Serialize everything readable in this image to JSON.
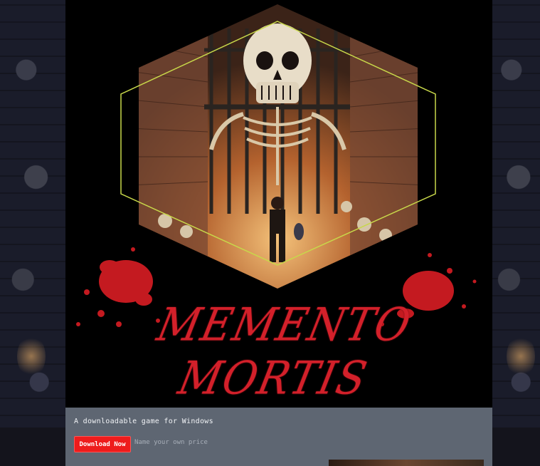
{
  "game": {
    "title": "MEMENTO MORTIS",
    "tagline": "A downloadable game for Windows",
    "download_label": "Download Now",
    "price_label": "Name your own price"
  },
  "colors": {
    "accent": "#ee1c1c",
    "title_red": "#d3202a",
    "panel_bg": "#5e6672",
    "banner_bg": "#000000",
    "hex_outline": "#c8d84a"
  },
  "icons": {
    "banner_art": "skeleton-dungeon-art",
    "blood_splatter": "blood-splatter-icon"
  }
}
